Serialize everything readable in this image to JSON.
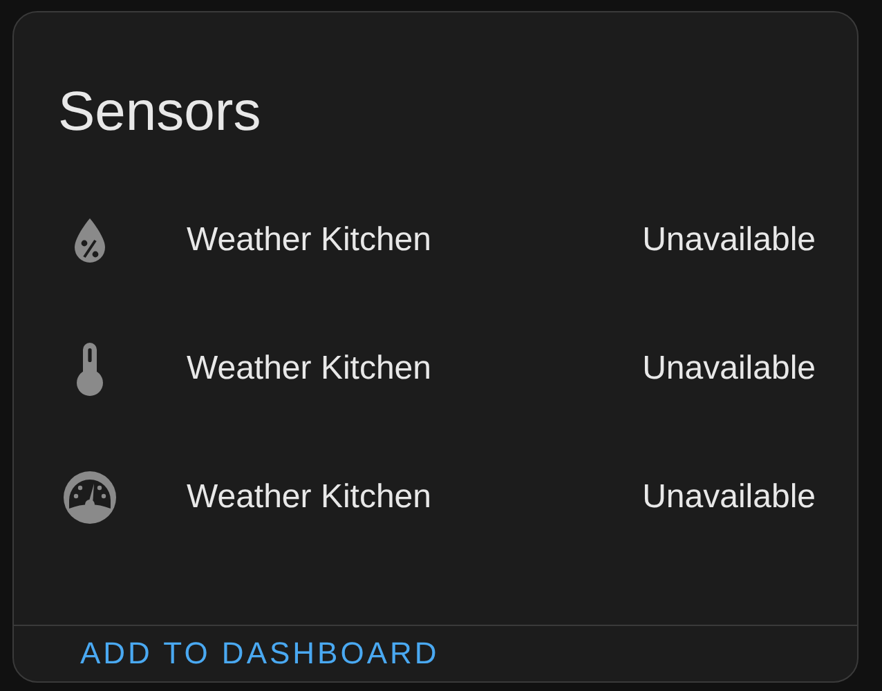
{
  "card": {
    "title": "Sensors",
    "rows": [
      {
        "kind": "humidity",
        "name": "Weather Kitchen",
        "state": "Unavailable"
      },
      {
        "kind": "temperature",
        "name": "Weather Kitchen",
        "state": "Unavailable"
      },
      {
        "kind": "pressure",
        "name": "Weather Kitchen",
        "state": "Unavailable"
      }
    ],
    "action": "ADD TO DASHBOARD"
  }
}
